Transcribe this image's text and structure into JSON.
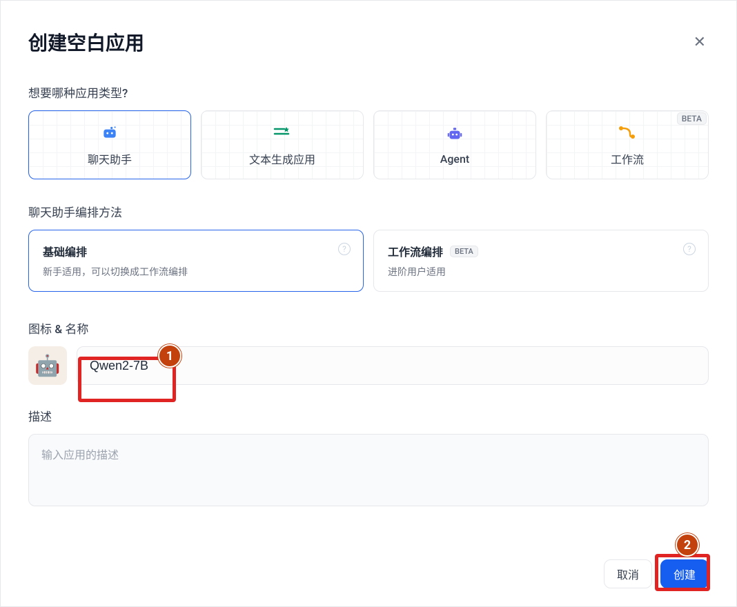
{
  "dialog": {
    "title": "创建空白应用",
    "close_icon": "✕"
  },
  "app_type": {
    "label": "想要哪种应用类型?",
    "cards": [
      {
        "id": "chat",
        "label": "聊天助手",
        "selected": true,
        "beta": false
      },
      {
        "id": "textgen",
        "label": "文本生成应用",
        "selected": false,
        "beta": false
      },
      {
        "id": "agent",
        "label": "Agent",
        "selected": false,
        "beta": false
      },
      {
        "id": "workflow",
        "label": "工作流",
        "selected": false,
        "beta": true
      }
    ],
    "beta_text": "BETA"
  },
  "orchestration": {
    "label": "聊天助手编排方法",
    "cards": [
      {
        "id": "basic",
        "title": "基础编排",
        "desc": "新手适用，可以切换成工作流编排",
        "selected": true,
        "beta": false
      },
      {
        "id": "workflow",
        "title": "工作流编排",
        "desc": "进阶用户适用",
        "selected": false,
        "beta": true
      }
    ],
    "beta_text": "BETA"
  },
  "name_section": {
    "label": "图标 & 名称",
    "avatar_emoji": "🤖",
    "input_value": "Qwen2-7B"
  },
  "description": {
    "label": "描述",
    "placeholder": "输入应用的描述",
    "value": ""
  },
  "footer": {
    "cancel": "取消",
    "create": "创建"
  },
  "annotations": {
    "marker1": "1",
    "marker2": "2"
  }
}
